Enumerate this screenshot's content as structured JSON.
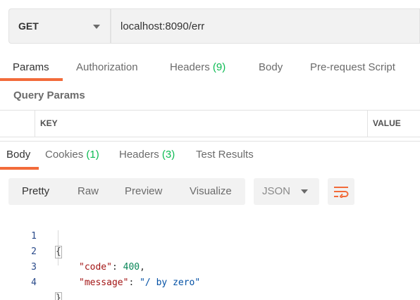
{
  "request": {
    "method": "GET",
    "url": "localhost:8090/err"
  },
  "request_tabs": [
    {
      "label": "Params",
      "count": ""
    },
    {
      "label": "Authorization",
      "count": ""
    },
    {
      "label": "Headers ",
      "count": "(9)"
    },
    {
      "label": "Body",
      "count": ""
    },
    {
      "label": "Pre-request Script",
      "count": ""
    }
  ],
  "query_params": {
    "title": "Query Params",
    "columns": [
      "KEY",
      "VALUE"
    ]
  },
  "response_tabs": [
    {
      "label": "Body",
      "count": ""
    },
    {
      "label": "Cookies ",
      "count": "(1)"
    },
    {
      "label": "Headers ",
      "count": "(3)"
    },
    {
      "label": "Test Results",
      "count": ""
    }
  ],
  "view_modes": [
    "Pretty",
    "Raw",
    "Preview",
    "Visualize"
  ],
  "format": "JSON",
  "wrap_icon": "wrap-lines-icon",
  "code": {
    "line_numbers": [
      "1",
      "2",
      "3",
      "4"
    ],
    "open_brace": "{",
    "close_brace": "}",
    "key1": "\"code\"",
    "sep1": ": ",
    "val1": "400",
    "comma1": ",",
    "key2": "\"message\"",
    "sep2": ": ",
    "val2": "\"/ by zero\""
  },
  "colors": {
    "accent": "#f26b3a",
    "count_green": "#0cbb52"
  }
}
